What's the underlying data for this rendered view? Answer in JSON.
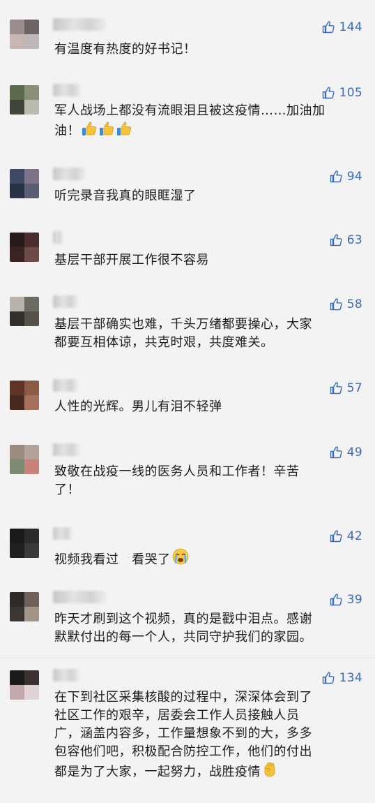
{
  "comments": [
    {
      "likes": "144",
      "text": "有温度有热度的好书记！",
      "avatar_colors": [
        "#9a8d8d",
        "#6e6466",
        "#c9b6b0",
        "#bfb7b9"
      ],
      "name_width": 76,
      "emoji_after": []
    },
    {
      "likes": "105",
      "text": "军人战场上都没有流眼泪且被这疫情……加油加\n油！",
      "avatar_colors": [
        "#5c6b4b",
        "#8a8f78",
        "#3f463a",
        "#b9bcae"
      ],
      "name_width": 40,
      "emoji_after": [
        "thumbs-up-emoji",
        "thumbs-up-emoji",
        "thumbs-up-emoji"
      ]
    },
    {
      "likes": "94",
      "text": "听完录音我真的眼眶湿了",
      "avatar_colors": [
        "#3e4a63",
        "#7d7286",
        "#2a3346",
        "#5b5d74"
      ],
      "name_width": 46,
      "emoji_after": []
    },
    {
      "likes": "63",
      "text": "基层干部开展工作很不容易",
      "avatar_colors": [
        "#2a1b1b",
        "#4b2d2b",
        "#3a2322",
        "#6b4a47"
      ],
      "name_width": 14,
      "emoji_after": []
    },
    {
      "likes": "58",
      "text": "基层干部确实也难，千头万绪都要操心，大家\n都要互相体谅，共克时艰，共度难关。",
      "avatar_colors": [
        "#b8b3ab",
        "#6c6a62",
        "#33302b",
        "#56524a"
      ],
      "name_width": 36,
      "emoji_after": []
    },
    {
      "likes": "57",
      "text": "人性的光辉。男儿有泪不轻弹",
      "avatar_colors": [
        "#5e3526",
        "#8a5a43",
        "#4a2a1f",
        "#a6705a"
      ],
      "name_width": 36,
      "emoji_after": []
    },
    {
      "likes": "49",
      "text": "致敬在战疫一线的医务人员和工作者！辛苦\n了！",
      "avatar_colors": [
        "#9c8b80",
        "#b2a39a",
        "#7e8b72",
        "#c7837a"
      ],
      "name_width": 38,
      "emoji_after": []
    },
    {
      "likes": "42",
      "text": "视频我看过   看哭了",
      "avatar_colors": [
        "#1a1a1a",
        "#2b2b2b",
        "#202020",
        "#3a3a3a"
      ],
      "name_width": 28,
      "emoji_after": [
        "crying-face-emoji"
      ]
    },
    {
      "likes": "39",
      "text": "昨天才刷到这个视频，真的是戳中泪点。感谢\n默默付出的每一个人，共同守护我们的家园。",
      "avatar_colors": [
        "#2e2a27",
        "#6e625a",
        "#3c3632",
        "#a39687"
      ],
      "name_width": 76,
      "emoji_after": []
    },
    {
      "likes": "134",
      "text": "在下到社区采集核酸的过程中，深深体会到了\n社区工作的艰辛，居委会工作人员接触人员\n广，涵盖内容多，工作量想象不到的大，多多\n包容他们吧，积极配合防控工作，他们的付出\n都是为了大家，一起努力，战胜疫情",
      "avatar_colors": [
        "#1d1a1a",
        "#3b3030",
        "#c5a8ad",
        "#e1d3d5"
      ],
      "name_width": 38,
      "emoji_after": [
        "raised-fist-emoji"
      ]
    }
  ]
}
